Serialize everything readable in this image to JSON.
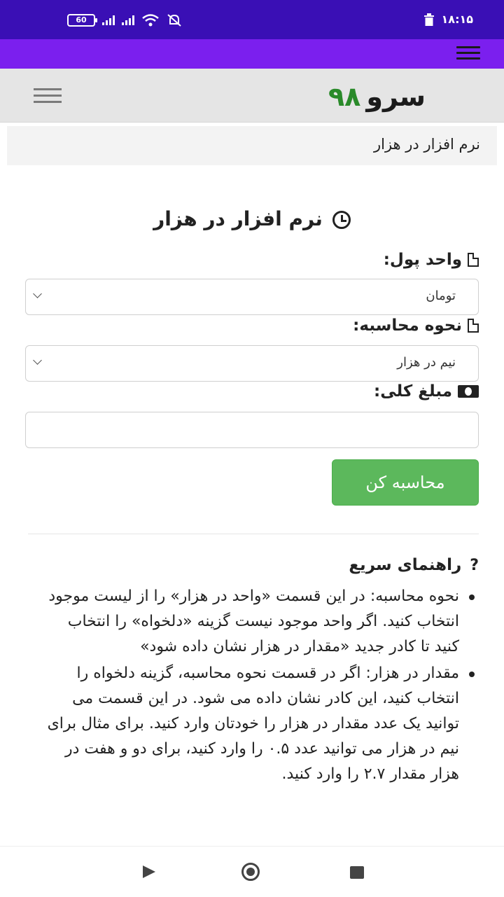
{
  "status_bar": {
    "battery": "60",
    "time": "۱۸:۱۵"
  },
  "site": {
    "logo_text": "سرو",
    "logo_number": "۹۸"
  },
  "breadcrumb": "نرم افزار در هزار",
  "page_title": "نرم افزار در هزار",
  "form": {
    "currency_label": "واحد پول:",
    "currency_value": "تومان",
    "method_label": "نحوه محاسبه:",
    "method_value": "نیم در هزار",
    "amount_label": "مبلغ کلی:",
    "amount_value": "",
    "submit_label": "محاسبه کن"
  },
  "help": {
    "title": "راهنمای سریع",
    "items": [
      "نحوه محاسبه: در این قسمت «واحد در هزار» را از لیست موجود انتخاب کنید. اگر واحد موجود نیست گزینه «دلخواه» را انتخاب کنید تا کادر جدید «مقدار در هزار نشان داده شود»",
      "مقدار در هزار: اگر در قسمت نحوه محاسبه، گزینه دلخواه را انتخاب کنید، این کادر نشان داده می شود. در این قسمت می توانید یک عدد مقدار در هزار را خودتان وارد کنید. برای مثال برای نیم در هزار می توانید عدد ۰.۵ را وارد کنید، برای دو و هفت در هزار مقدار ۲.۷ را وارد کنید."
    ]
  },
  "colors": {
    "status_bar": "#3a0fb5",
    "app_bar": "#7b1fee",
    "submit": "#5cb85c",
    "logo_number": "#2a8a2a"
  }
}
